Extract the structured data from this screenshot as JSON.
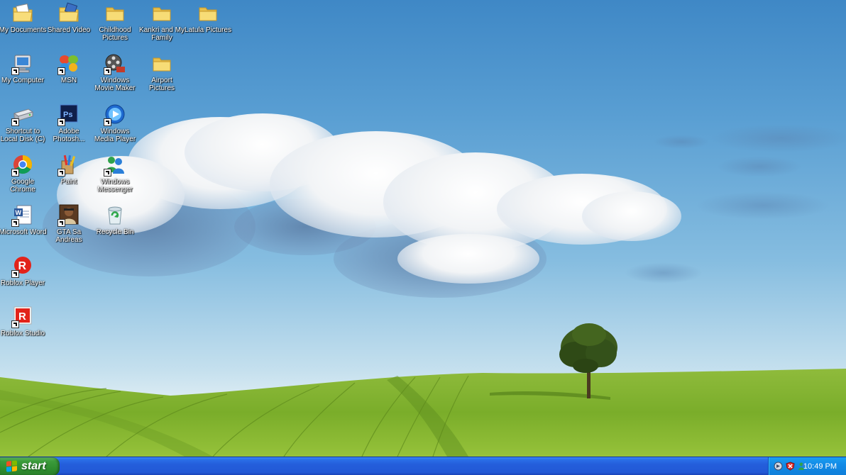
{
  "desktop": {
    "icons": [
      {
        "name": "my-documents",
        "label": "My Documents",
        "icon": "documents-folder-icon"
      },
      {
        "name": "shared-video",
        "label": "Shared Video",
        "icon": "video-folder-icon"
      },
      {
        "name": "childhood-pictures",
        "label": "Childhood Pictures",
        "icon": "folder-icon"
      },
      {
        "name": "kankri-family",
        "label": "Kankri and My Family",
        "icon": "folder-icon"
      },
      {
        "name": "latula-pictures",
        "label": "Latula Pictures",
        "icon": "folder-icon"
      },
      {
        "name": "my-computer",
        "label": "My Computer",
        "icon": "computer-icon"
      },
      {
        "name": "msn",
        "label": "MSN",
        "icon": "msn-butterfly-icon"
      },
      {
        "name": "movie-maker",
        "label": "Windows Movie Maker",
        "icon": "film-reel-icon"
      },
      {
        "name": "airport-pictures",
        "label": "Airport Pictures",
        "icon": "folder-icon"
      },
      {
        "name": "local-disk",
        "label": "Shortcut to Local Disk (C)",
        "icon": "hard-disk-icon"
      },
      {
        "name": "photoshop",
        "label": "Adobe Photosh...",
        "icon": "photoshop-icon"
      },
      {
        "name": "media-player",
        "label": "Windows Media Player",
        "icon": "media-player-icon"
      },
      {
        "name": "chrome",
        "label": "Google Chrome",
        "icon": "chrome-icon"
      },
      {
        "name": "paint",
        "label": "Paint",
        "icon": "paint-icon"
      },
      {
        "name": "messenger",
        "label": "Windows Messenger",
        "icon": "messenger-icon"
      },
      {
        "name": "word",
        "label": "Microsoft Word",
        "icon": "word-icon"
      },
      {
        "name": "gta-sa",
        "label": "GTA Sa Andreas",
        "icon": "gta-icon"
      },
      {
        "name": "recycle-bin",
        "label": "Recycle Bin",
        "icon": "recycle-bin-icon"
      },
      {
        "name": "roblox-player",
        "label": "Roblox Player",
        "icon": "roblox-icon"
      },
      {
        "name": "roblox-studio",
        "label": "Roblox Studio",
        "icon": "roblox-studio-icon"
      }
    ]
  },
  "taskbar": {
    "start_label": "start",
    "tray_icons": [
      "network-icon",
      "security-alert-icon",
      "messenger-status-icon"
    ],
    "clock": "10:49 PM"
  },
  "colors": {
    "taskbar_blue": "#245edb",
    "start_green": "#3c9c3c",
    "tray_blue": "#128be6"
  }
}
